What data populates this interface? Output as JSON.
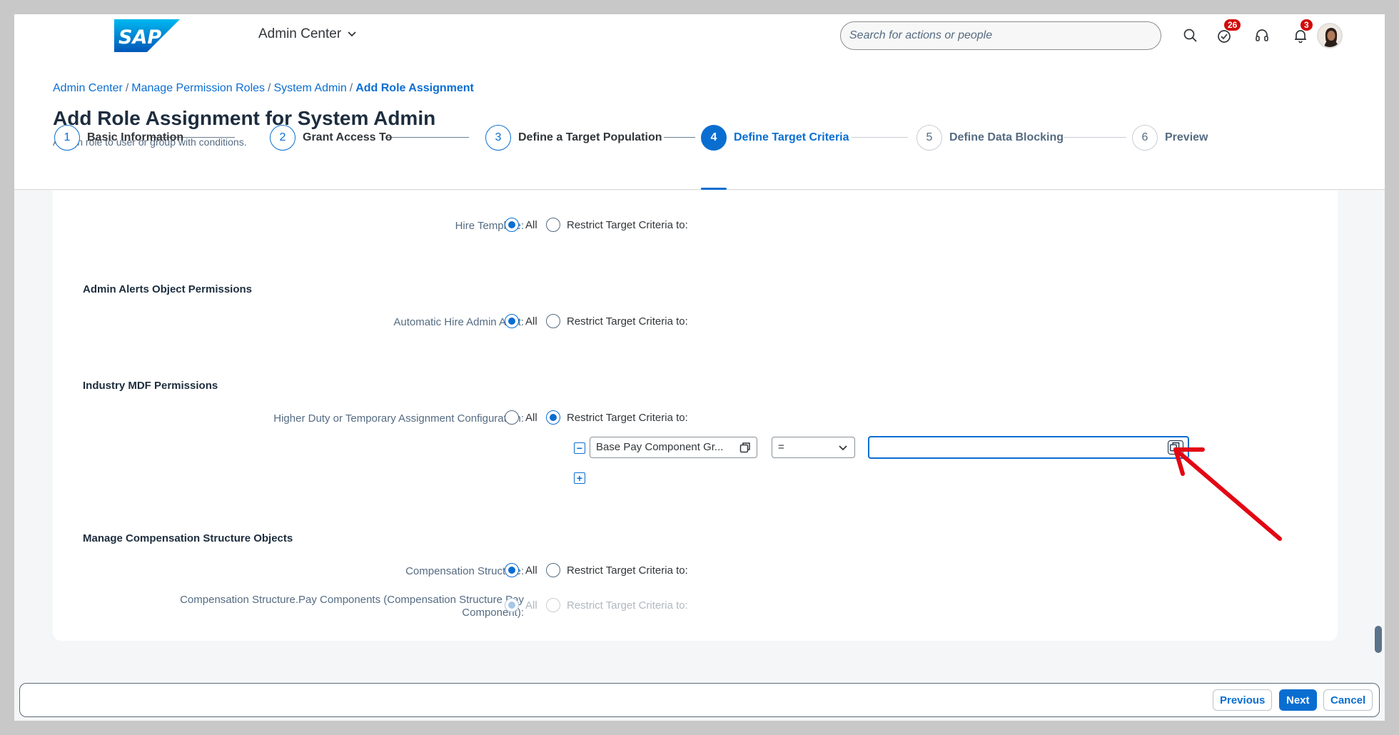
{
  "shell": {
    "app_title": "Admin Center",
    "search_placeholder": "Search for actions or people",
    "todo_count": "26",
    "notification_count": "3"
  },
  "breadcrumb": [
    {
      "label": "Admin Center"
    },
    {
      "label": "Manage Permission Roles"
    },
    {
      "label": "System Admin"
    },
    {
      "label": "Add Role Assignment"
    }
  ],
  "header": {
    "title": "Add Role Assignment for System Admin",
    "subtitle": "Assign role to user or group with conditions."
  },
  "wizard": {
    "steps": [
      {
        "num": "1",
        "label": "Basic Information",
        "state": "completed"
      },
      {
        "num": "2",
        "label": "Grant Access To",
        "state": "completed"
      },
      {
        "num": "3",
        "label": "Define a Target Population",
        "state": "completed"
      },
      {
        "num": "4",
        "label": "Define Target Criteria",
        "state": "active"
      },
      {
        "num": "5",
        "label": "Define Data Blocking",
        "state": "upcoming"
      },
      {
        "num": "6",
        "label": "Preview",
        "state": "upcoming"
      }
    ]
  },
  "content": {
    "options": {
      "all": "All",
      "restrict": "Restrict Target Criteria to:"
    },
    "hire_template": {
      "label": "Hire Template:",
      "selected": "all"
    },
    "admin_alerts": {
      "title": "Admin Alerts Object Permissions",
      "automatic_hire": {
        "label": "Automatic Hire Admin Alert:",
        "selected": "all"
      }
    },
    "industry_mdf": {
      "title": "Industry MDF Permissions",
      "higher_duty": {
        "label": "Higher Duty or Temporary Assignment Configuration:",
        "selected": "restrict",
        "criteria": {
          "field": "Base Pay Component Gr...",
          "operator": "=",
          "value": ""
        }
      }
    },
    "comp_structure": {
      "title": "Manage Compensation Structure Objects",
      "structure": {
        "label": "Compensation Structure:",
        "selected": "all"
      },
      "pay_components": {
        "label": "Compensation Structure.Pay Components (Compensation Structure Pay Component):",
        "selected": "all",
        "disabled": true
      }
    }
  },
  "footer": {
    "previous": "Previous",
    "next": "Next",
    "cancel": "Cancel"
  },
  "colors": {
    "accent": "#0a6ed1",
    "badge": "#d20a0a",
    "annotation_arrow": "#e30613"
  }
}
